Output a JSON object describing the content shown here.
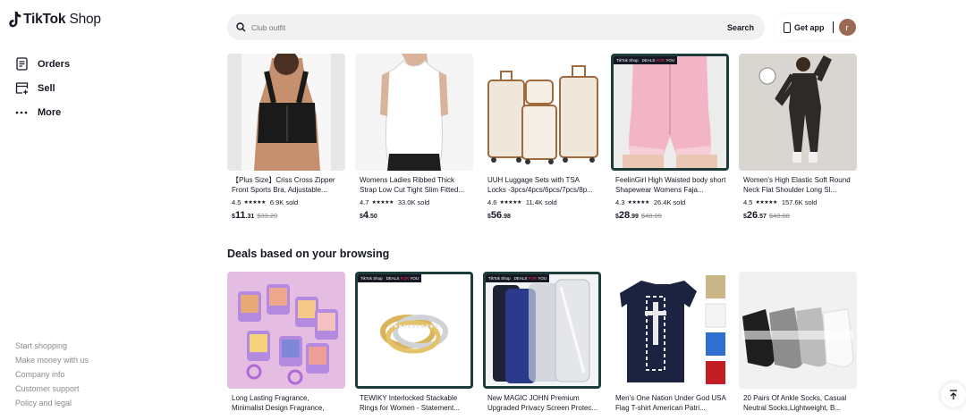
{
  "brand": {
    "name": "TikTok",
    "suffix": "Shop"
  },
  "nav": [
    {
      "label": "Orders",
      "icon": "orders-icon"
    },
    {
      "label": "Sell",
      "icon": "sell-icon"
    },
    {
      "label": "More",
      "icon": "more-icon"
    }
  ],
  "footer": [
    "Start shopping",
    "Make money with us",
    "Company info",
    "Customer support",
    "Policy and legal"
  ],
  "search": {
    "placeholder": "Club outfit",
    "button": "Search"
  },
  "header": {
    "get_app": "Get app",
    "avatar_letter": "r"
  },
  "deal_tag": {
    "brand": "TikTok Shop",
    "label_a": "DEALS",
    "label_b": "FOR",
    "label_c": "YOU"
  },
  "row1": [
    {
      "title": "【Plus Size】Criss Cross Zipper Front Sports Bra, Adjustable...",
      "rating": "4.5",
      "stars": "★★★★★",
      "sold": "6.9K sold",
      "currency": "$",
      "price": "11",
      "cents": ".31",
      "orig": "$33.29",
      "deal": false
    },
    {
      "title": "Womens Ladies Ribbed Thick Strap Low Cut Tight Slim Fitted...",
      "rating": "4.7",
      "stars": "★★★★★",
      "sold": "33.0K sold",
      "currency": "$",
      "price": "4",
      "cents": ".50",
      "orig": "",
      "deal": false
    },
    {
      "title": "UUH Luggage Sets with TSA Locks -3pcs/4pcs/6pcs/7pcs/8p...",
      "rating": "4.6",
      "stars": "★★★★★",
      "sold": "11.4K sold",
      "currency": "$",
      "price": "56",
      "cents": ".98",
      "orig": "",
      "deal": false
    },
    {
      "title": "FeelinGirl High Waisted body short Shapewear Womens Faja...",
      "rating": "4.3",
      "stars": "★★★★★",
      "sold": "26.4K sold",
      "currency": "$",
      "price": "28",
      "cents": ".99",
      "orig": "$48.99",
      "deal": true
    },
    {
      "title": "Women's High Elastic Soft Round Neck Flat Shoulder Long Sl...",
      "rating": "4.5",
      "stars": "★★★★★",
      "sold": "157.6K sold",
      "currency": "$",
      "price": "26",
      "cents": ".57",
      "orig": "$40.88",
      "deal": false
    }
  ],
  "section_title": "Deals based on your browsing",
  "row2": [
    {
      "title": "Long Lasting Fragrance, Minimalist Design Fragrance, Suitabl...",
      "deal": false
    },
    {
      "title": "TEWIKY Interlocked Stackable Rings for Women - Statement...",
      "deal": true
    },
    {
      "title": "New MAGIC JOHN Premium Upgraded Privacy Screen Protec...",
      "deal": true
    },
    {
      "title": "Men's One Nation Under God USA Flag T-shirt American Patri...",
      "deal": false
    },
    {
      "title": "20 Pairs Of Ankle Socks, Casual Neutral Socks,Lightweight, B...",
      "deal": false
    }
  ],
  "product_icons": [
    "sports-bra-image",
    "tank-top-image",
    "luggage-set-image",
    "shapewear-image",
    "bodysuit-image",
    "fragrance-image",
    "rings-image",
    "screen-protector-image",
    "flag-tshirt-image",
    "socks-image"
  ],
  "colors": {
    "accent": "#fe2c55",
    "deal_border": "#1c3d39",
    "avatar": "#9b6a55"
  }
}
